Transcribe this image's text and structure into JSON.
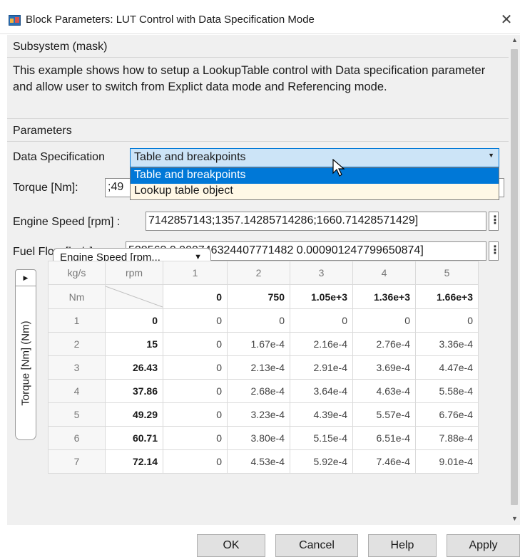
{
  "window": {
    "title": "Block Parameters: LUT Control with Data Specification Mode",
    "close_glyph": "✕"
  },
  "mask": {
    "header": "Subsystem (mask)",
    "description": "This example shows how to setup a LookupTable control with Data specification parameter and allow user to switch from Explict data mode and Referencing mode."
  },
  "parameters": {
    "header": "Parameters",
    "data_spec": {
      "label": "Data Specification",
      "value": "Table and breakpoints",
      "options": [
        "Table and breakpoints",
        "Lookup table object"
      ]
    },
    "torque": {
      "label": "Torque [Nm]:",
      "value": ";49"
    },
    "engine_speed": {
      "label": "Engine Speed [rpm] :",
      "value": "7142857143;1357.14285714286;1660.71428571429]"
    },
    "fuel_flow": {
      "label": "Fuel Flow [kg/s] :",
      "value": "528563 0.000746324407771482 0.000901247799650874]"
    },
    "kebab_glyph": "⋮"
  },
  "lut": {
    "axis_dropdown": "Engine Speed [rpm...",
    "side_label": "Torque [Nm] (Nm)",
    "corner_units_top": "kg/s",
    "corner_units_bottom": "Nm",
    "corner_axis": "rpm",
    "col_indices": [
      "1",
      "2",
      "3",
      "4",
      "5"
    ],
    "col_breakpoints": [
      "0",
      "750",
      "1.05e+3",
      "1.36e+3",
      "1.66e+3"
    ],
    "rows": [
      {
        "index": "1",
        "bp": "0",
        "values": [
          "0",
          "0",
          "0",
          "0",
          "0"
        ]
      },
      {
        "index": "2",
        "bp": "15",
        "values": [
          "0",
          "1.67e-4",
          "2.16e-4",
          "2.76e-4",
          "3.36e-4"
        ]
      },
      {
        "index": "3",
        "bp": "26.43",
        "values": [
          "0",
          "2.13e-4",
          "2.91e-4",
          "3.69e-4",
          "4.47e-4"
        ]
      },
      {
        "index": "4",
        "bp": "37.86",
        "values": [
          "0",
          "2.68e-4",
          "3.64e-4",
          "4.63e-4",
          "5.58e-4"
        ]
      },
      {
        "index": "5",
        "bp": "49.29",
        "values": [
          "0",
          "3.23e-4",
          "4.39e-4",
          "5.57e-4",
          "6.76e-4"
        ]
      },
      {
        "index": "6",
        "bp": "60.71",
        "values": [
          "0",
          "3.80e-4",
          "5.15e-4",
          "6.51e-4",
          "7.88e-4"
        ]
      },
      {
        "index": "7",
        "bp": "72.14",
        "values": [
          "0",
          "4.53e-4",
          "5.92e-4",
          "7.46e-4",
          "9.01e-4"
        ]
      }
    ]
  },
  "buttons": {
    "ok": "OK",
    "cancel": "Cancel",
    "help": "Help",
    "apply": "Apply"
  },
  "colors": {
    "selection": "#0078d7",
    "select_bg": "#cce4f7",
    "dropdown_bg": "#fff8e6",
    "panel_bg": "#f0f0f0"
  }
}
